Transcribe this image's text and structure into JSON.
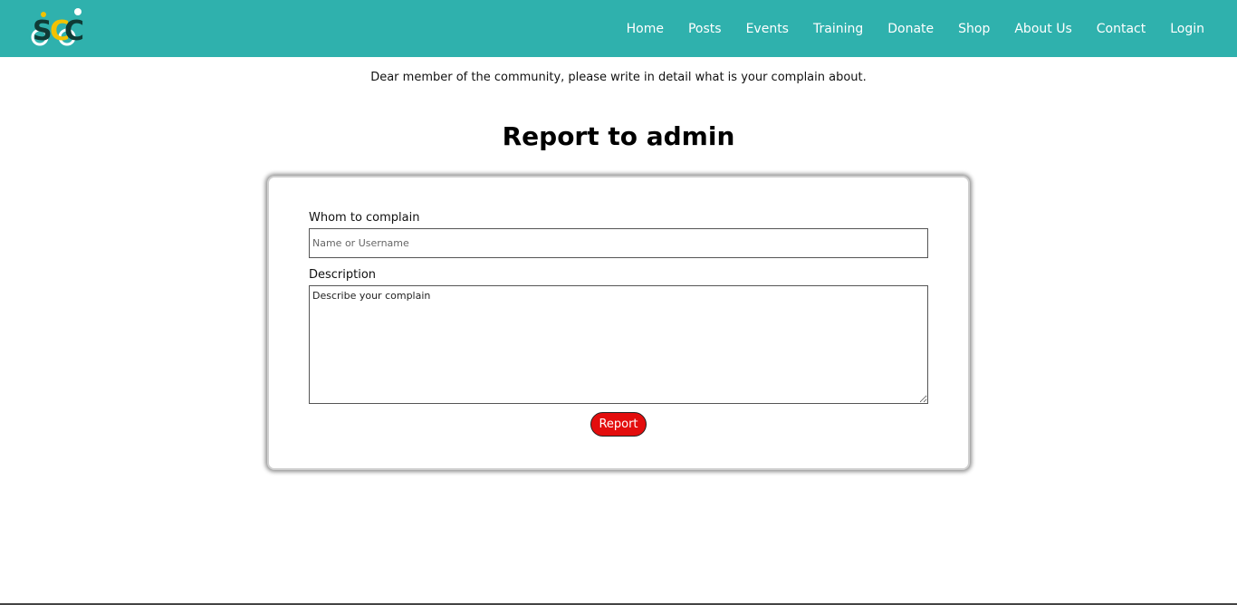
{
  "brand": {
    "logo_text": "SCC",
    "logo_icon": "scc-cyclists-logo"
  },
  "colors": {
    "navbar": "#2fb1ad",
    "logo_dark": "#0f3b36",
    "logo_yellow": "#f2c200",
    "report_button": "#e30d0d"
  },
  "nav": {
    "items": [
      {
        "label": "Home"
      },
      {
        "label": "Posts"
      },
      {
        "label": "Events"
      },
      {
        "label": "Training"
      },
      {
        "label": "Donate"
      },
      {
        "label": "Shop"
      },
      {
        "label": "About Us"
      },
      {
        "label": "Contact"
      },
      {
        "label": "Login"
      }
    ]
  },
  "intro": "Dear member of the community, please write in detail what is your complain about.",
  "title": "Report to admin",
  "form": {
    "whom_label": "Whom to complain",
    "whom_placeholder": "Name or Username",
    "whom_value": "",
    "desc_label": "Description",
    "desc_placeholder": "Describe your complain",
    "desc_value": "",
    "submit_label": "Report"
  }
}
